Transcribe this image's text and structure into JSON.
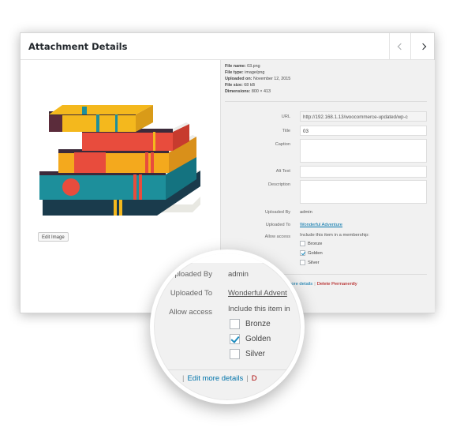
{
  "modal": {
    "title": "Attachment Details",
    "prev_icon": "chevron-left-icon",
    "next_icon": "chevron-right-icon"
  },
  "preview": {
    "edit_image_label": "Edit Image",
    "image_icon": "stacked-books-image"
  },
  "file_info": {
    "file_name_label": "File name:",
    "file_name": "03.png",
    "file_type_label": "File type:",
    "file_type": "image/png",
    "uploaded_on_label": "Uploaded on:",
    "uploaded_on": "November 12, 2015",
    "file_size_label": "File size:",
    "file_size": "68 kB",
    "dimensions_label": "Dimensions:",
    "dimensions": "800 × 413"
  },
  "fields": {
    "url_label": "URL",
    "url_value": "http://192.168.1.13/woocommerce-updated/wp-c",
    "title_label": "Title",
    "title_value": "03",
    "caption_label": "Caption",
    "caption_value": "",
    "alt_label": "Alt Text",
    "alt_value": "",
    "description_label": "Description",
    "description_value": "",
    "uploaded_by_label": "Uploaded By",
    "uploaded_by_value": "admin",
    "uploaded_to_label": "Uploaded To",
    "uploaded_to_value": "Wonderful Adventure",
    "allow_access_label": "Allow access",
    "allow_access_hint": "Include this item in a membership:",
    "memberships": [
      {
        "label": "Bronze",
        "checked": false
      },
      {
        "label": "Golden",
        "checked": true
      },
      {
        "label": "Silver",
        "checked": false
      }
    ]
  },
  "actions": {
    "edit_more": "Edit more details",
    "separator": "|",
    "delete": "Delete Permanently"
  },
  "magnifier": {
    "uploaded_by_label": "Uploaded By",
    "uploaded_by_value": "admin",
    "uploaded_to_label": "Uploaded To",
    "uploaded_to_value": "Wonderful Advent",
    "allow_access_label": "Allow access",
    "allow_access_hint": "Include this item in",
    "edit_more": "Edit more details",
    "separator": "|",
    "delete_fragment": "D",
    "left_separator": "|"
  },
  "colors": {
    "link": "#0073aa",
    "delete": "#aa0000",
    "checkmark": "#1e8cbe",
    "pane_bg": "#f1f1f1"
  }
}
